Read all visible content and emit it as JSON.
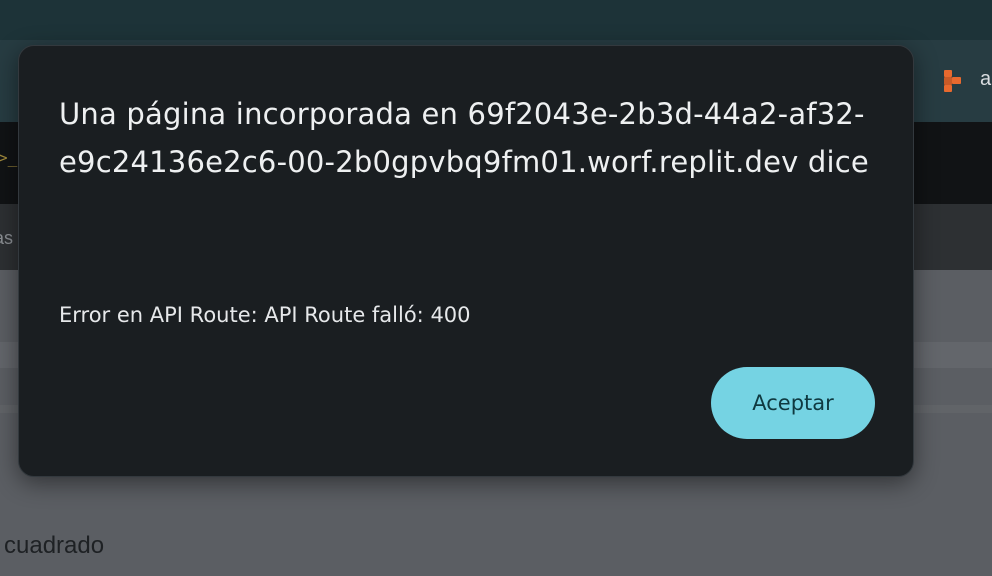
{
  "background": {
    "toolbar_text": "a",
    "prompt_glyph": ">_",
    "strip_text": "as",
    "bottom_text": "cuadrado",
    "logo_icon": "replit-logo-icon",
    "logo_color": "#e8692e"
  },
  "dialog": {
    "title": "Una página incorporada en 69f2043e-2b3d-44a2-af32-e9c24136e2c6-00-2b0gpvbq9fm01.worf.replit.dev dice",
    "message": "Error en API Route: API Route falló: 400",
    "accept_label": "Aceptar",
    "accent_color": "#75d3e3"
  }
}
